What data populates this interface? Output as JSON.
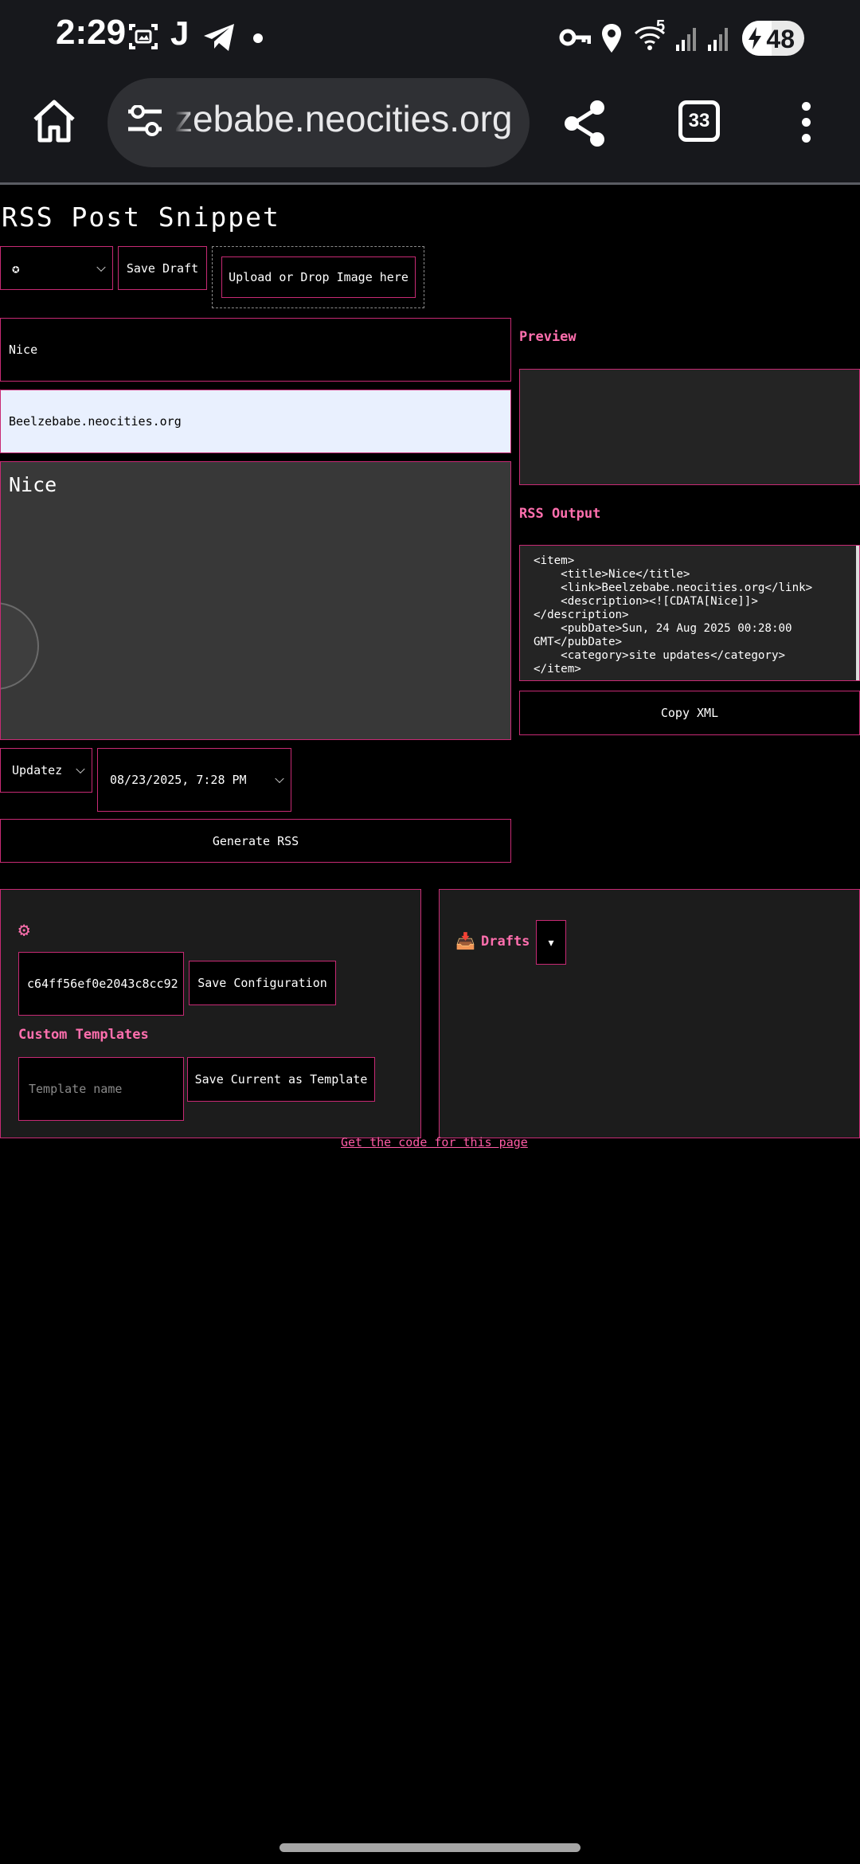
{
  "status_bar": {
    "time": "2:29",
    "notification_letter": "J",
    "wifi_badge": "5",
    "battery_level": "48",
    "battery_fraction": 0.48
  },
  "browser": {
    "url_display": "zebabe.neocities.org",
    "tab_count": "33"
  },
  "page": {
    "title": "RSS Post Snippet",
    "emoji_select_value": "✪",
    "save_draft_label": "Save Draft",
    "upload_label": "Upload or Drop Image here",
    "title_input_value": "Nice",
    "link_input_value": "Beelzebabe.neocities.org",
    "description_value": "Nice",
    "category_select_value": "Updatez",
    "date_value": "08/23/2025, 7:28 PM",
    "generate_label": "Generate RSS",
    "preview_heading": "Preview",
    "rss_output_heading": "RSS Output",
    "rss_output_text": "<item>\n    <title>Nice</title>\n    <link>Beelzebabe.neocities.org</link>\n    <description><![CDATA[Nice]]>\n</description>\n    <pubDate>Sun, 24 Aug 2025 00:28:00\nGMT</pubDate>\n    <category>site updates</category>\n</item>",
    "copy_xml_label": "Copy XML",
    "config": {
      "gear_glyph": "⚙",
      "api_key_value": "c64ff56ef0e2043c8cc92",
      "save_config_label": "Save Configuration",
      "templates_heading": "Custom Templates",
      "template_name_placeholder": "Template name",
      "save_template_label": "Save Current as Template"
    },
    "drafts": {
      "icon_glyph": "📥",
      "label": "Drafts",
      "toggle_glyph": "▾"
    },
    "footer_link": "Get the code for this page"
  },
  "colors": {
    "accent_border": "#c72a74",
    "accent_text": "#ff6fae",
    "link_input_bg": "#e9f0fe"
  }
}
